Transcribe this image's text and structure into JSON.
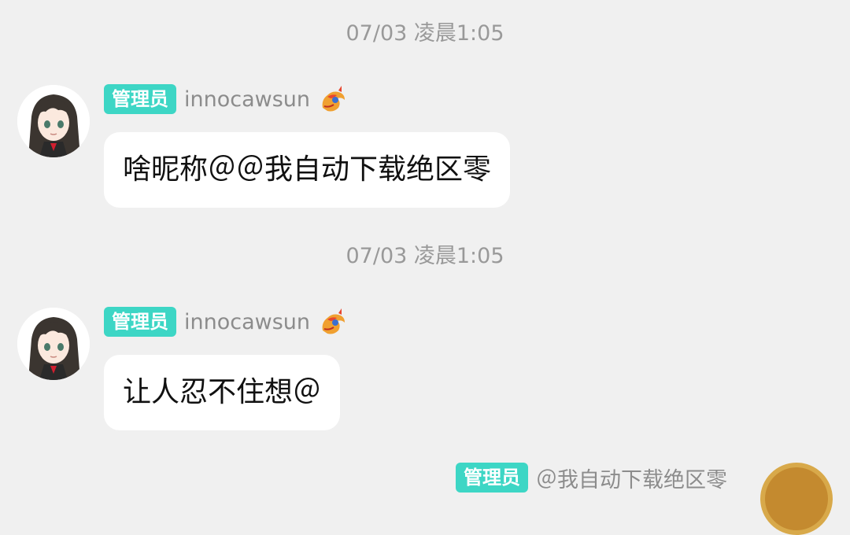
{
  "messages": [
    {
      "timestamp": "07/03 凌晨1:05",
      "role": "管理员",
      "username": "innocawsun",
      "medal_icon": "dragon-medal-icon",
      "text": "啥昵称＠＠我自动下载绝区零"
    },
    {
      "timestamp": "07/03 凌晨1:05",
      "role": "管理员",
      "username": "innocawsun",
      "medal_icon": "dragon-medal-icon",
      "text": "让人忍不住想＠"
    }
  ],
  "self_message": {
    "role": "管理员",
    "text": "＠我自动下载绝区零"
  },
  "colors": {
    "background": "#f0f0f0",
    "badge": "#3dd6c5",
    "bubble": "#ffffff",
    "timestamp": "#999999",
    "username": "#8c8c8c"
  }
}
